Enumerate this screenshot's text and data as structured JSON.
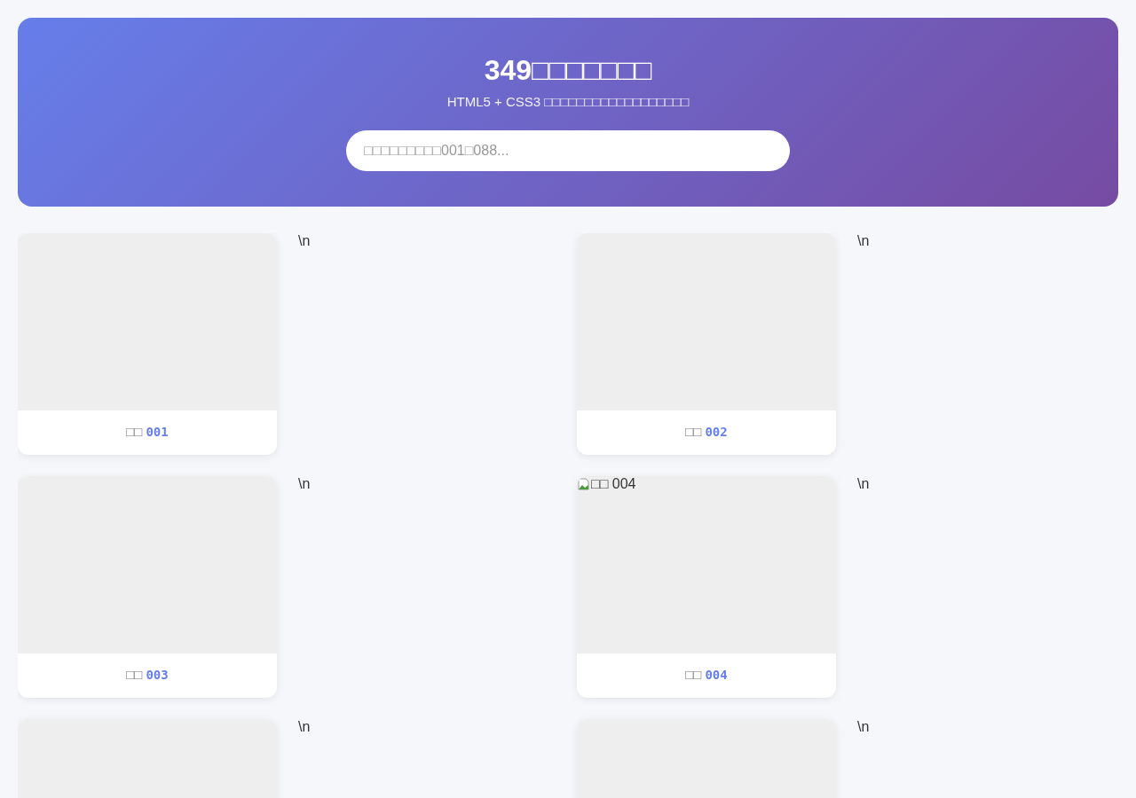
{
  "header": {
    "title": "349□□□□□□□",
    "subtitle": "HTML5 + CSS3 □□□□□□□□□□□□□□□□□□",
    "search": {
      "placeholder": "□□□□□□□□□001□088..."
    }
  },
  "items": [
    {
      "image_broken": false,
      "caption_prefix": "□□",
      "caption_number": "001",
      "note": "\\n"
    },
    {
      "image_broken": false,
      "caption_prefix": "□□",
      "caption_number": "002",
      "note": "\\n"
    },
    {
      "image_broken": false,
      "caption_prefix": "□□",
      "caption_number": "003",
      "note": "\\n"
    },
    {
      "image_broken": true,
      "image_alt": "□□ 004",
      "caption_prefix": "□□",
      "caption_number": "004",
      "note": "\\n"
    },
    {
      "image_broken": false,
      "note": "\\n"
    },
    {
      "image_broken": false,
      "note": "\\n"
    }
  ]
}
